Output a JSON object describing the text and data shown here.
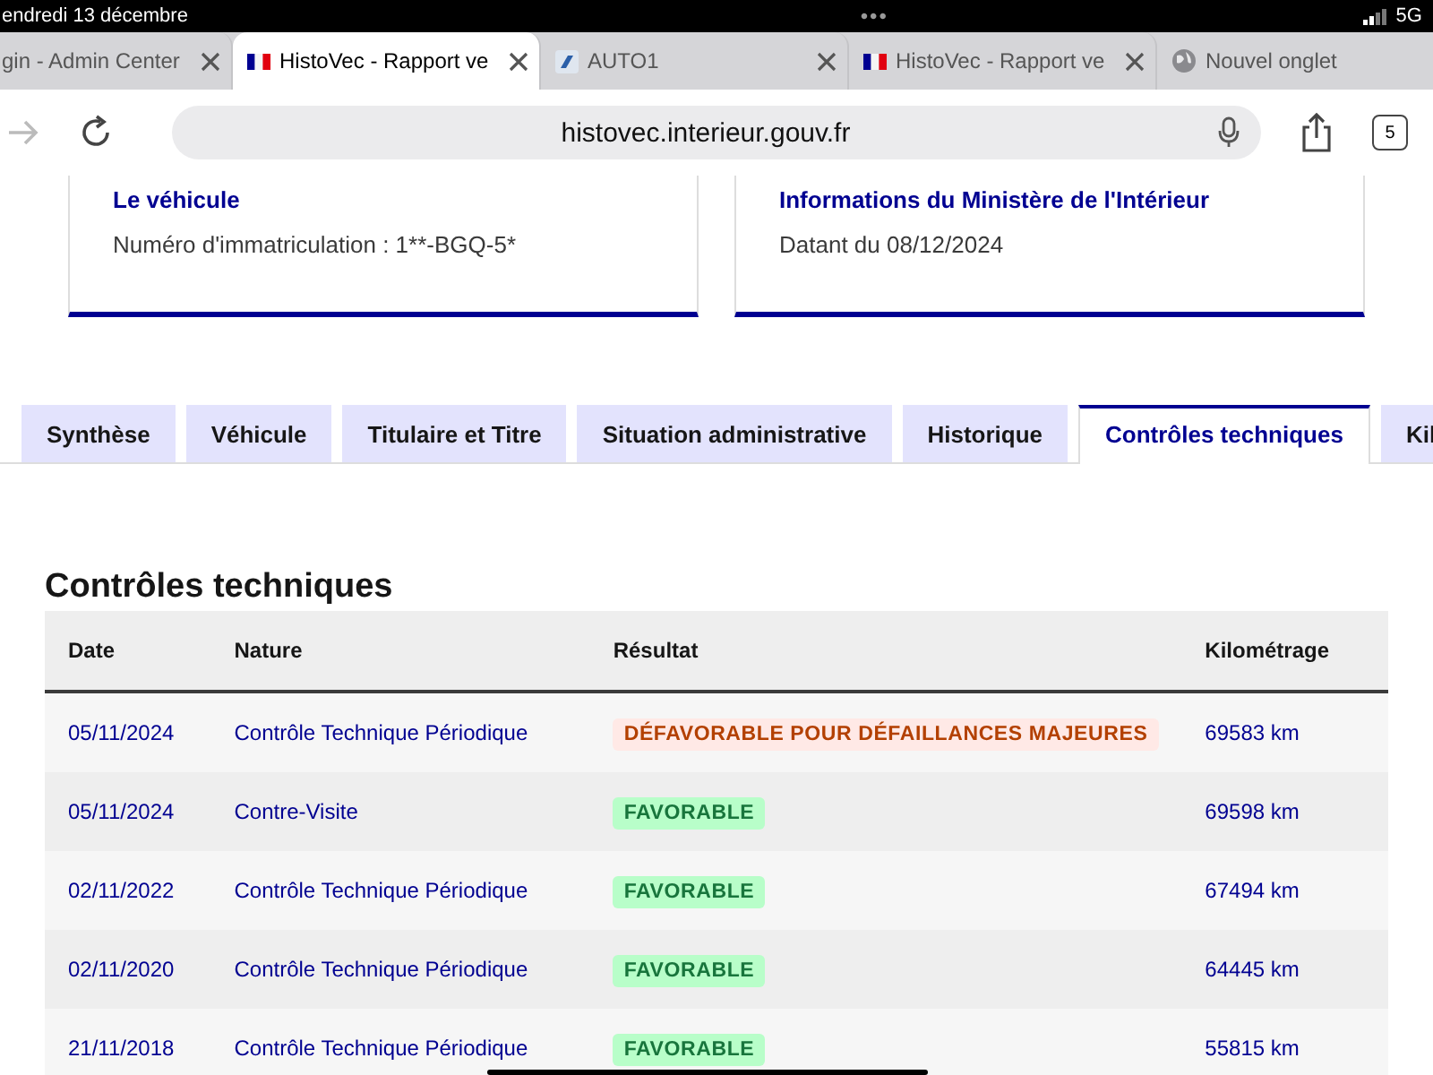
{
  "status_bar": {
    "date": "endredi 13 décembre",
    "dots": "•••",
    "network": "5G"
  },
  "browser_tabs": [
    {
      "title": "gin - Admin Center",
      "kind": "plain",
      "selected": false
    },
    {
      "title": "HistoVec - Rapport ve",
      "kind": "flag",
      "selected": true
    },
    {
      "title": "AUTO1",
      "kind": "app",
      "selected": false
    },
    {
      "title": "HistoVec - Rapport ve",
      "kind": "flag",
      "selected": false
    },
    {
      "title": "Nouvel onglet",
      "kind": "globe",
      "selected": false
    }
  ],
  "toolbar": {
    "url": "histovec.interieur.gouv.fr",
    "tab_count": "5"
  },
  "cards": [
    {
      "title": "Le véhicule",
      "text": "Numéro d'immatriculation : 1**-BGQ-5*"
    },
    {
      "title": "Informations du Ministère de l'Intérieur",
      "text": "Datant du 08/12/2024"
    }
  ],
  "tabs": [
    {
      "label": "Synthèse",
      "selected": false
    },
    {
      "label": "Véhicule",
      "selected": false
    },
    {
      "label": "Titulaire et Titre",
      "selected": false
    },
    {
      "label": "Situation administrative",
      "selected": false
    },
    {
      "label": "Historique",
      "selected": false
    },
    {
      "label": "Contrôles techniques",
      "selected": true
    },
    {
      "label": "Kil",
      "selected": false
    }
  ],
  "section_title": "Contrôles techniques",
  "table": {
    "columns": [
      "Date",
      "Nature",
      "Résultat",
      "Kilométrage"
    ],
    "rows": [
      {
        "date": "05/11/2024",
        "nature": "Contrôle Technique Périodique",
        "result": "DÉFAVORABLE POUR DÉFAILLANCES MAJEURES",
        "kind": "error",
        "mileage": "69583 km"
      },
      {
        "date": "05/11/2024",
        "nature": "Contre-Visite",
        "result": "FAVORABLE",
        "kind": "success",
        "mileage": "69598 km"
      },
      {
        "date": "02/11/2022",
        "nature": "Contrôle Technique Périodique",
        "result": "FAVORABLE",
        "kind": "success",
        "mileage": "67494 km"
      },
      {
        "date": "02/11/2020",
        "nature": "Contrôle Technique Périodique",
        "result": "FAVORABLE",
        "kind": "success",
        "mileage": "64445 km"
      },
      {
        "date": "21/11/2018",
        "nature": "Contrôle Technique Périodique",
        "result": "FAVORABLE",
        "kind": "success",
        "mileage": "55815 km"
      }
    ]
  }
}
